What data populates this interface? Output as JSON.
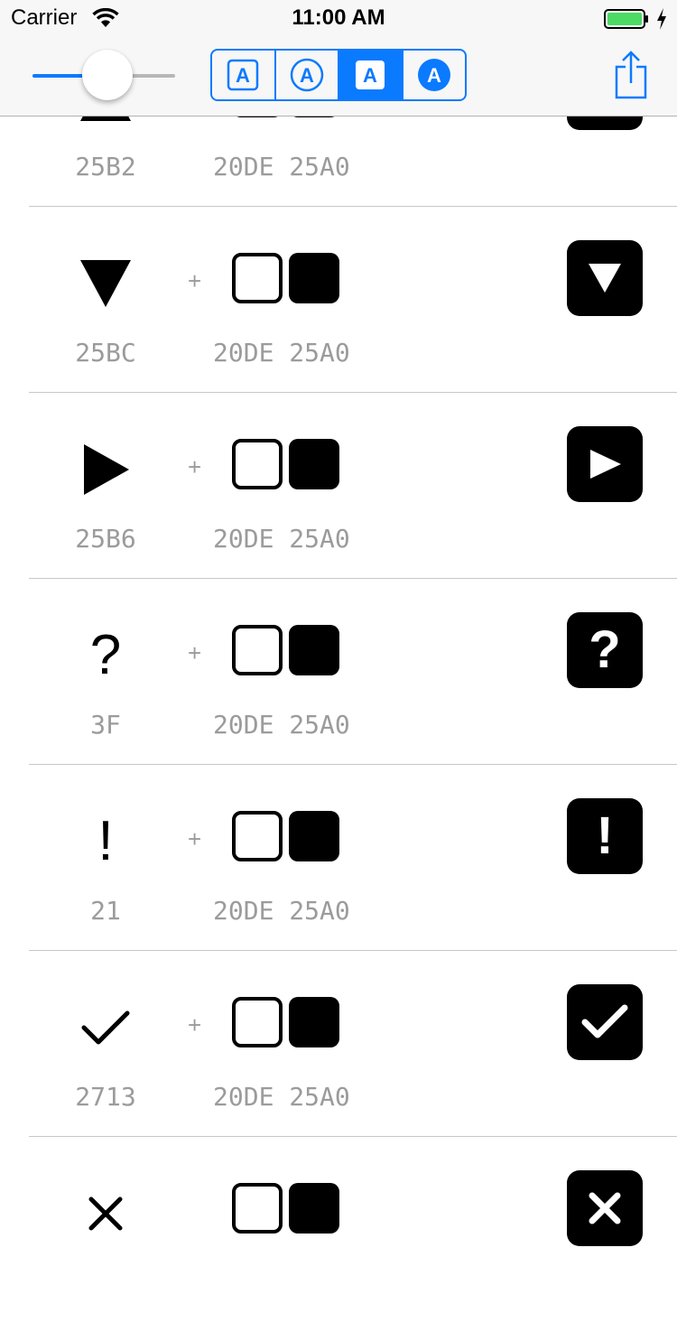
{
  "status_bar": {
    "carrier": "Carrier",
    "time": "11:00 AM",
    "battery_color": "#4cd964"
  },
  "toolbar": {
    "slider_value": 0.48,
    "segments": [
      {
        "icon": "letter-a-square-outline-icon",
        "letter": "A",
        "selected": false
      },
      {
        "icon": "letter-a-circle-outline-icon",
        "letter": "A",
        "selected": false
      },
      {
        "icon": "letter-a-square-filled-icon",
        "letter": "A",
        "selected": true
      },
      {
        "icon": "letter-a-circle-filled-icon",
        "letter": "A",
        "selected": false
      }
    ],
    "accent": "#0a7aff",
    "share_icon": "share-icon"
  },
  "rows": [
    {
      "glyph": "▲",
      "glyph_icon": "triangle-up-icon",
      "code": "25B2",
      "combo": "20DE 25A0",
      "plus": "+",
      "result_icon": "triangle-up-enclosed-icon"
    },
    {
      "glyph": "▼",
      "glyph_icon": "triangle-down-icon",
      "code": "25BC",
      "combo": "20DE 25A0",
      "plus": "+",
      "result_icon": "triangle-down-enclosed-icon"
    },
    {
      "glyph": "▶",
      "glyph_icon": "triangle-right-icon",
      "code": "25B6",
      "combo": "20DE 25A0",
      "plus": "+",
      "result_icon": "triangle-right-enclosed-icon"
    },
    {
      "glyph": "?",
      "glyph_icon": "question-mark-icon",
      "code": "3F",
      "combo": "20DE 25A0",
      "plus": "+",
      "result": "?",
      "result_icon": "question-enclosed-icon"
    },
    {
      "glyph": "!",
      "glyph_icon": "exclamation-mark-icon",
      "code": "21",
      "combo": "20DE 25A0",
      "plus": "+",
      "result": "!",
      "result_icon": "exclamation-enclosed-icon"
    },
    {
      "glyph": "✓",
      "glyph_icon": "check-mark-icon",
      "code": "2713",
      "combo": "20DE 25A0",
      "plus": "+",
      "result_icon": "check-enclosed-icon"
    },
    {
      "glyph": "✕",
      "glyph_icon": "x-mark-icon",
      "code": "",
      "combo": "",
      "plus": "",
      "result_icon": "x-enclosed-icon"
    }
  ]
}
